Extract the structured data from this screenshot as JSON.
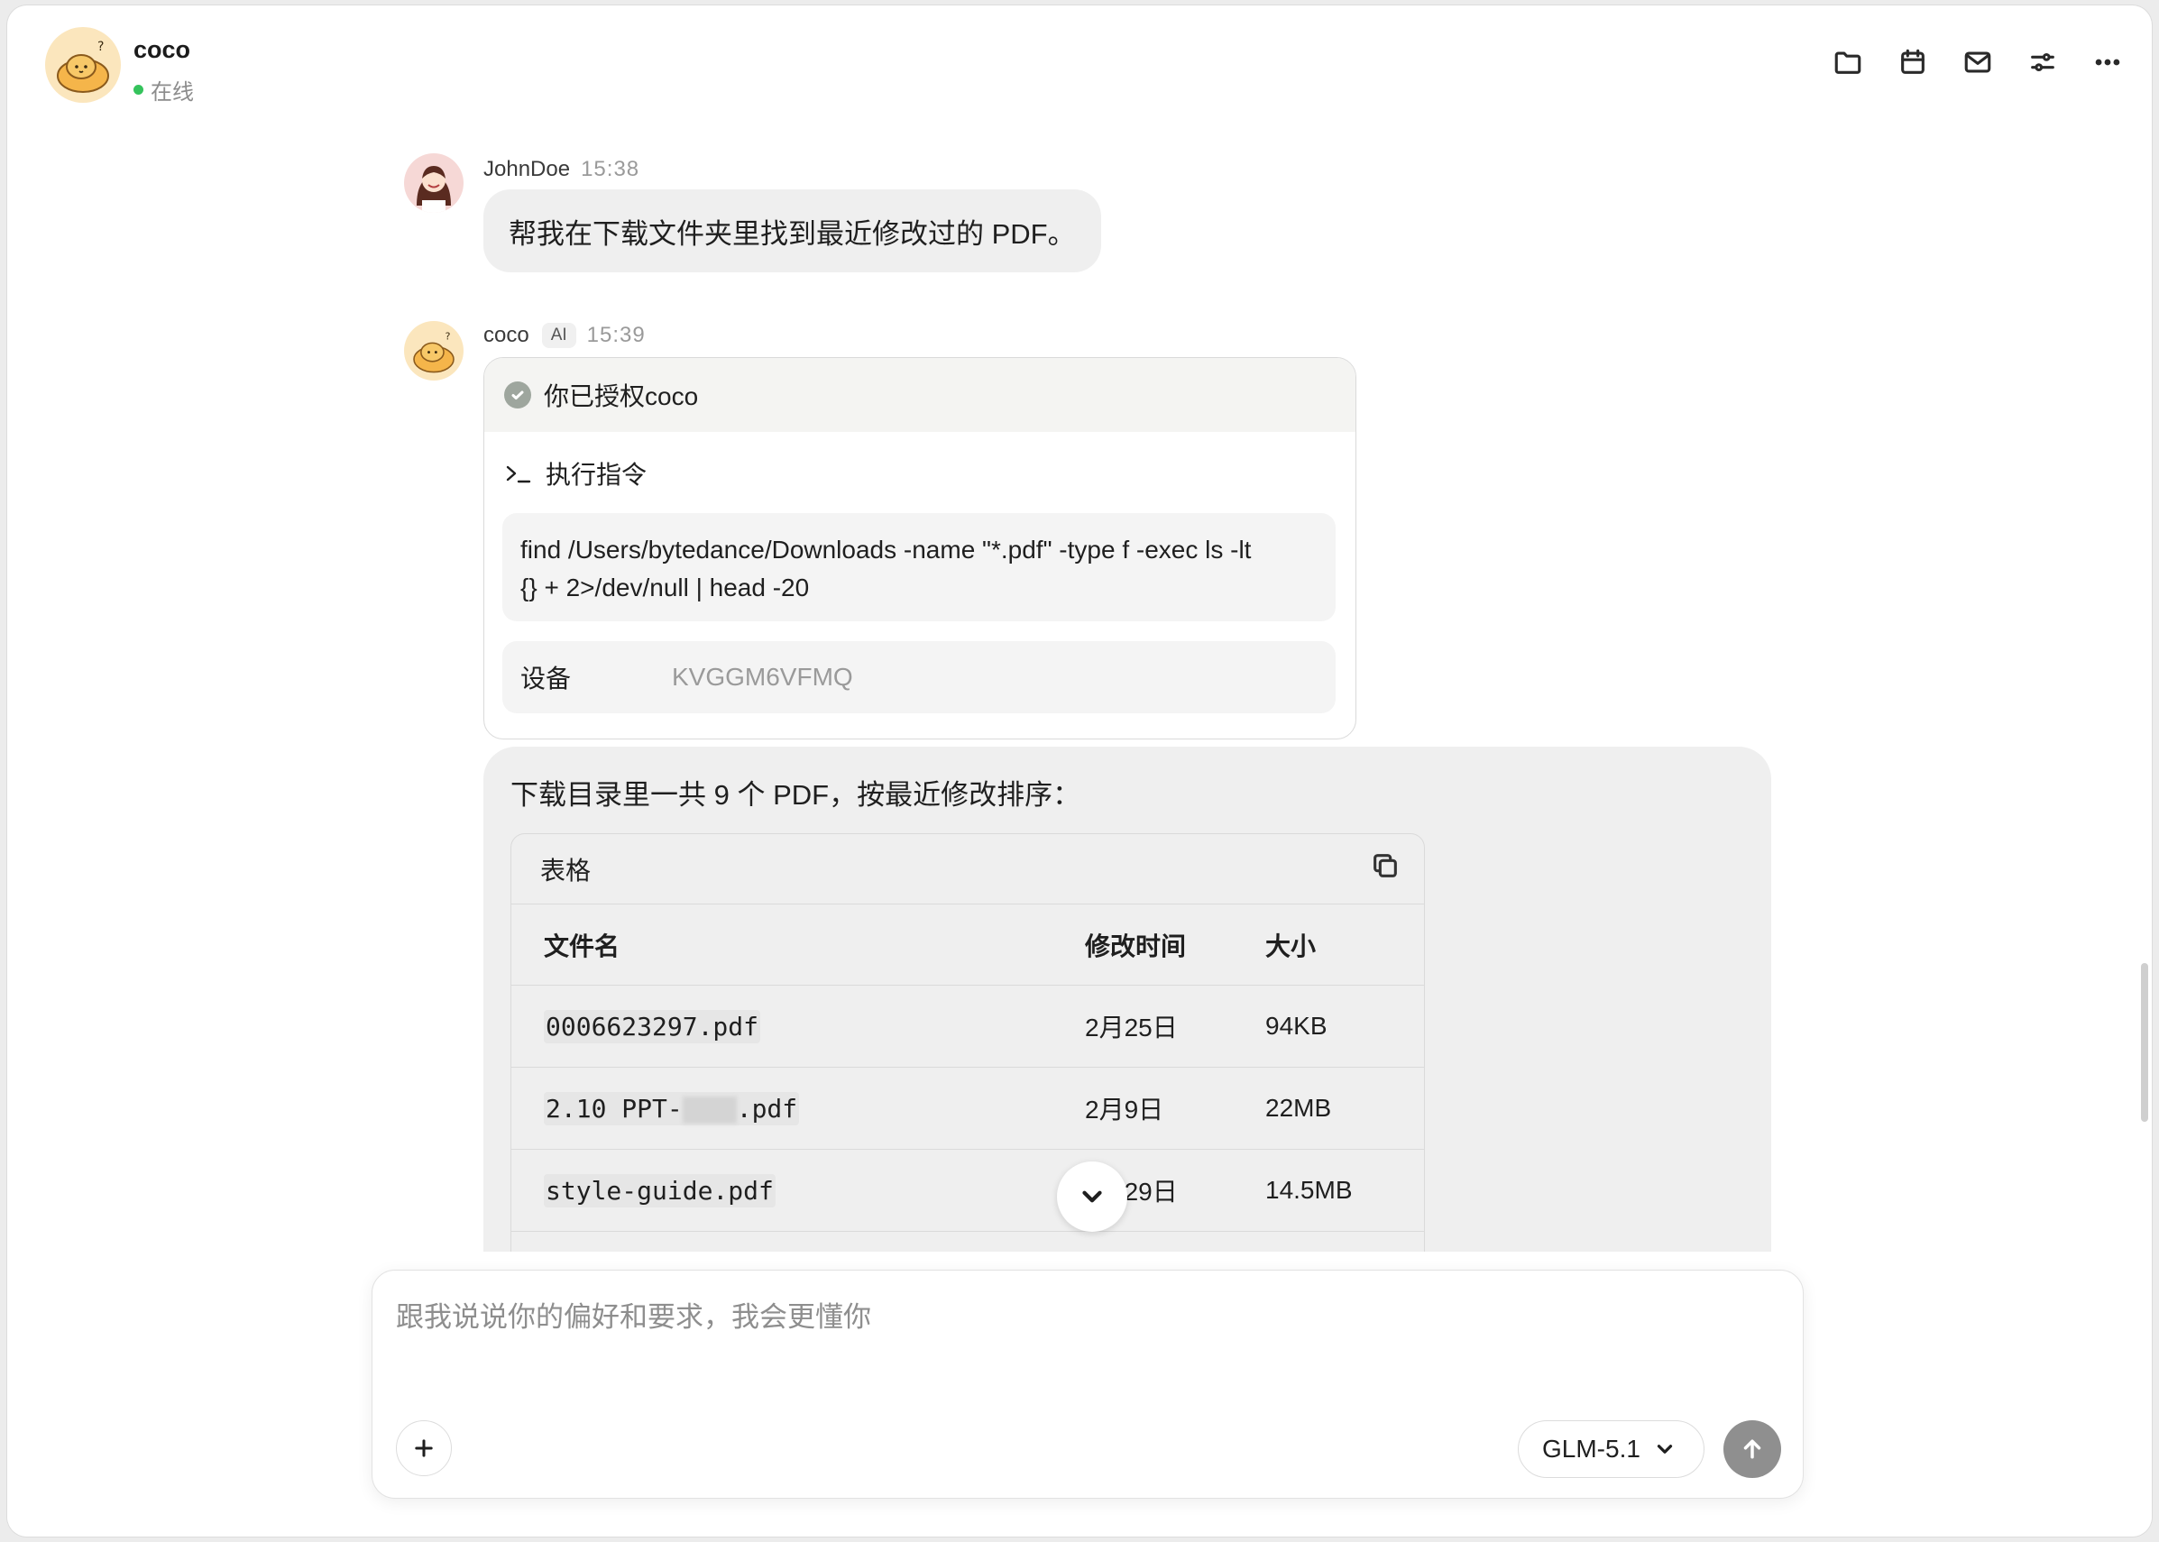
{
  "header": {
    "agent_name": "coco",
    "status": "在线",
    "toolbar_icons": [
      "folder-icon",
      "calendar-icon",
      "mail-icon",
      "settings-sliders-icon",
      "more-icon"
    ]
  },
  "user_message": {
    "author": "JohnDoe",
    "time": "15:38",
    "text": "帮我在下载文件夹里找到最近修改过的 PDF。"
  },
  "ai_message": {
    "author": "coco",
    "badge": "AI",
    "time": "15:39",
    "auth_card": {
      "title": "你已授权coco",
      "exec_label": "执行指令",
      "command_line1": "find /Users/bytedance/Downloads -name \"*.pdf\" -type f -exec ls -lt",
      "command_line2": "{} + 2>/dev/null | head -20",
      "device_label": "设备",
      "device_value": "KVGGM6VFMQ"
    },
    "reply_text": "下载目录里一共 9 个 PDF，按最近修改排序：",
    "table": {
      "title": "表格",
      "columns": [
        "文件名",
        "修改时间",
        "大小"
      ],
      "rows": [
        {
          "name": "0006623297.pdf",
          "modified": "2月25日",
          "size": "94KB"
        },
        {
          "name_prefix": "2.10 PPT-",
          "name_suffix": ".pdf",
          "modified": "2月9日",
          "size": "22MB"
        },
        {
          "name": "style-guide.pdf",
          "modified": "1月29日",
          "size": "14.5MB"
        }
      ]
    }
  },
  "composer": {
    "placeholder": "跟我说说你的偏好和要求，我会更懂你",
    "value": "",
    "model": "GLM-5.1"
  },
  "colors": {
    "status_online": "#35c35c",
    "bubble_bg": "#efefef",
    "send_button": "#8f8f8f"
  }
}
